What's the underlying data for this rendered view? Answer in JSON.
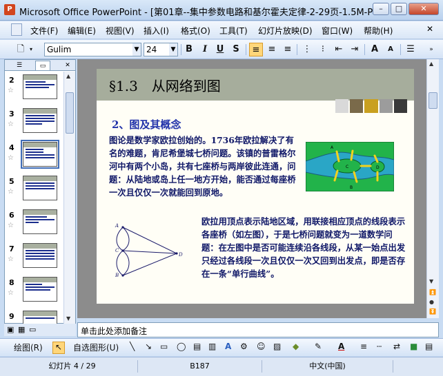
{
  "window": {
    "title": "Microsoft Office PowerPoint - [第01章--集中参数电路和基尔霍夫定律-2-29页-1.5M-PPT..."
  },
  "menu": {
    "items": [
      "文件(F)",
      "编辑(E)",
      "视图(V)",
      "插入(I)",
      "格式(O)",
      "工具(T)",
      "幻灯片放映(D)",
      "窗口(W)",
      "帮助(H)"
    ]
  },
  "toolbar": {
    "font": "Gulim",
    "size": "24",
    "bold": "B",
    "italic": "I",
    "underline": "U",
    "shadow": "S"
  },
  "thumbnails": {
    "numbers": [
      "2",
      "3",
      "4",
      "5",
      "6",
      "7",
      "8",
      "9"
    ],
    "selected": "4"
  },
  "slide": {
    "title": "§1.3　从网络到图",
    "subtitle": "2、图及其概念",
    "para1": "图论是数学家欧拉创始的。1736年欧拉解决了有名的难题，肯尼希堡城七桥问题。该镇的普雷格尔河中有两个小岛，共有七座桥与两岸彼此连通，问题：从陆地或岛上任一地方开始，能否通过每座桥一次且仅仅一次就能回到原地。",
    "para2": "欧拉用顶点表示陆地区域，用联接相应顶点的线段表示各座桥（如左图），于是七桥问题就变为一道数学问题：在左图中是否可能连续沿各线段，从某一始点出发只经过各线段一次且仅仅一次又回到出发点，即是否存在一条“单行曲线”。",
    "graph_labels": {
      "a": "A",
      "b": "B",
      "c": "C",
      "d": "D"
    },
    "map_labels": {
      "a": "A",
      "b": "B",
      "c": "C",
      "d": "D"
    }
  },
  "notes": {
    "placeholder": "单击此处添加备注"
  },
  "drawing": {
    "draw_label": "绘图(R)",
    "autoshape_label": "自选图形(U)"
  },
  "status": {
    "slide": "幻灯片 4 / 29",
    "template": "B187",
    "language": "中文(中国)"
  },
  "colors": {
    "accent": "#3e6bb5",
    "title_band": "#a6ad9c",
    "text_blue": "#101868",
    "water": "#2aa6c6",
    "land": "#22b34a",
    "bridge": "#f2d21d"
  }
}
